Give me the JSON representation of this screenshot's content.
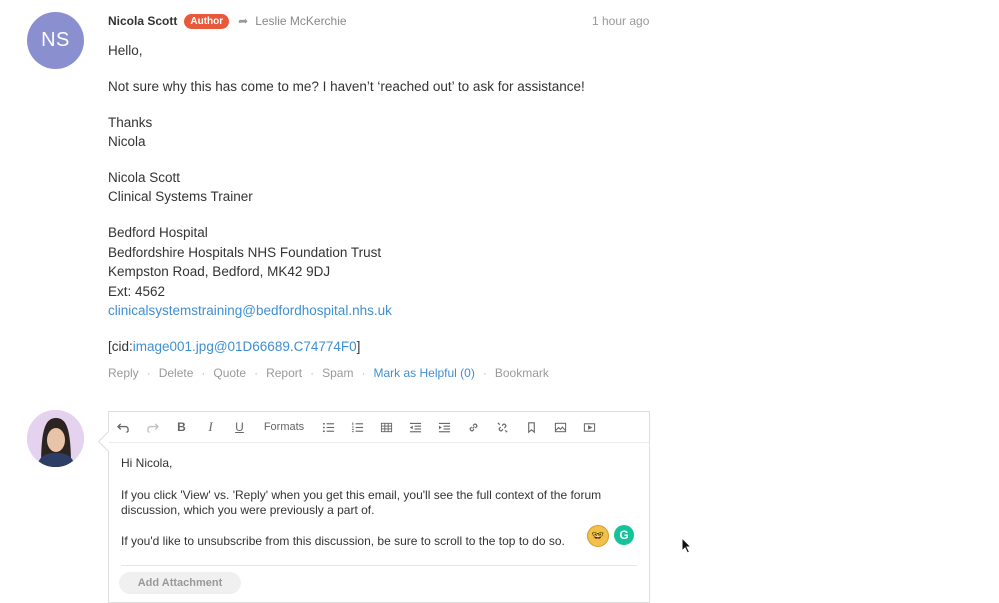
{
  "post": {
    "initials": "NS",
    "author": "Nicola Scott",
    "badge": "Author",
    "recipient": "Leslie McKerchie",
    "time": "1 hour ago",
    "lines": [
      "Hello,",
      "Not sure why this has come to me? I haven’t ‘reached out’ to ask for assistance!",
      "Thanks",
      "Nicola",
      "Nicola Scott",
      "Clinical Systems Trainer",
      "Bedford Hospital",
      "Bedfordshire Hospitals NHS Foundation Trust",
      "Kempston Road, Bedford, MK42 9DJ",
      "Ext: 4562"
    ],
    "email_link": "clinicalsystemstraining@bedfordhospital.nhs.uk",
    "cid_prefix": "[cid:",
    "cid_link": "image001.jpg@01D66689.C74774F0",
    "cid_suffix": "]",
    "actions": {
      "reply": "Reply",
      "delete": "Delete",
      "quote": "Quote",
      "report": "Report",
      "spam": "Spam",
      "helpful": "Mark as Helpful (0)",
      "bookmark": "Bookmark",
      "separator": "·"
    }
  },
  "editor": {
    "toolbar": {
      "undo_icon": "undo-icon",
      "redo_icon": "redo-icon",
      "bold": "B",
      "italic": "I",
      "underline": "U",
      "formats": "Formats"
    },
    "lines": [
      "Hi Nicola,",
      "If you click 'View' vs. 'Reply' when you get this email, you'll see the full context of the forum",
      "discussion, which you were previously a part of.",
      "If you'd like to unsubscribe from this discussion, be sure to scroll to the top to do so."
    ],
    "grammarly_letter": "G",
    "attach_label": "Add Attachment"
  },
  "colors": {
    "badge": "#e8593c",
    "link": "#3f8fd2",
    "avatar": "#8a8fcf",
    "grammarly": "#15c39a"
  }
}
